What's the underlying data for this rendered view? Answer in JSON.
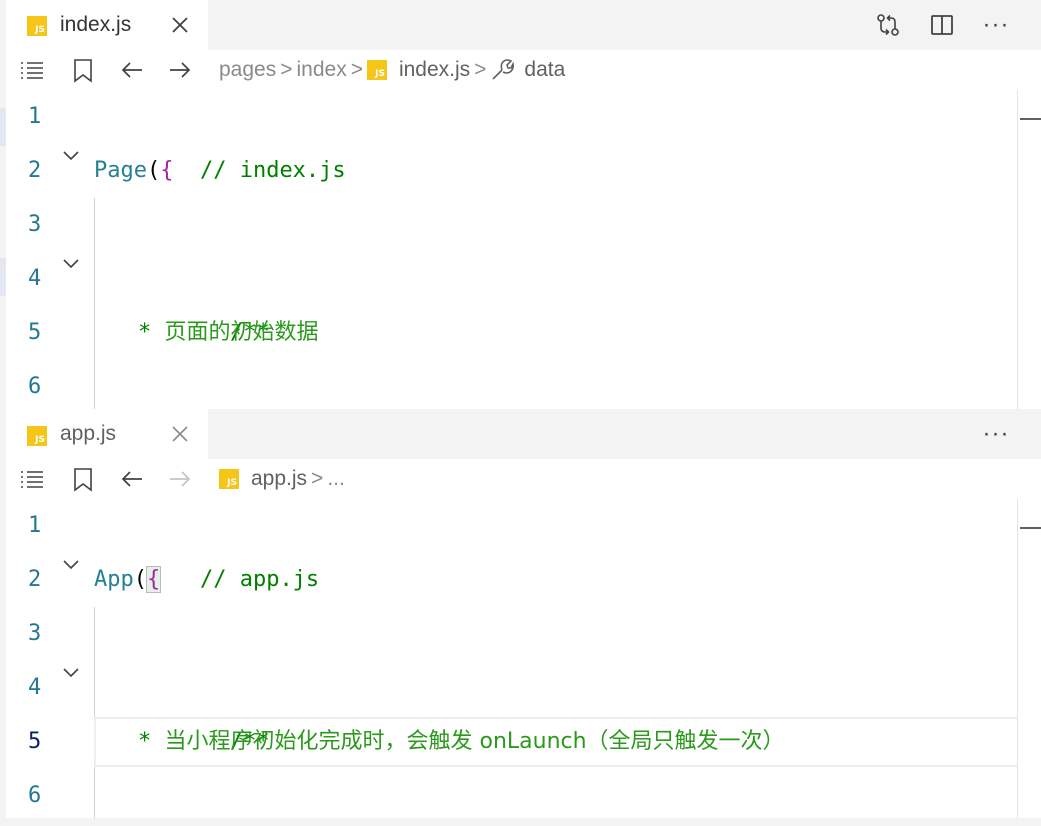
{
  "theme": {
    "tab_active_bg": "#ffffff",
    "tab_bar_bg": "#f3f3f3",
    "js_icon_color": "#f5c518",
    "line_number_color": "#237893",
    "comment_color": "#008000",
    "identifier_color": "#267f99",
    "brace_color": "#a626a4"
  },
  "top_editor": {
    "tab": {
      "icon_text": "JS",
      "label": "index.js",
      "close_icon": "close-icon"
    },
    "actions": [
      "compare-changes-icon",
      "split-editor-icon",
      "more-actions-icon"
    ],
    "more_label": "···",
    "nav": {
      "list_icon": "outline-icon",
      "bookmark_icon": "bookmark-icon",
      "back_icon": "arrow-left-icon",
      "forward_icon": "arrow-right-icon"
    },
    "breadcrumbs": {
      "folder1": "pages",
      "folder2": "index",
      "file_icon": "JS",
      "file": "index.js",
      "symbol_icon": "wrench-icon",
      "symbol": "data",
      "separator": ">"
    },
    "lines": [
      {
        "number": "1",
        "text": "// index.js"
      },
      {
        "number": "2",
        "ident": "Page",
        "paren": "(",
        "brace": "{"
      },
      {
        "number": "3",
        "text": ""
      },
      {
        "number": "4",
        "text": "/**"
      },
      {
        "number": "5",
        "prefix": "* ",
        "text": "页面的初始数据"
      },
      {
        "number": "6",
        "text": "*/"
      }
    ]
  },
  "bottom_editor": {
    "tab": {
      "icon_text": "JS",
      "label": "app.js",
      "close_icon": "close-icon"
    },
    "actions": [
      "more-actions-icon"
    ],
    "more_label": "···",
    "nav": {
      "list_icon": "outline-icon",
      "bookmark_icon": "bookmark-icon",
      "back_icon": "arrow-left-icon",
      "forward_icon": "arrow-right-icon"
    },
    "breadcrumbs": {
      "file_icon": "JS",
      "file": "app.js",
      "separator": ">",
      "ellipsis": "..."
    },
    "lines": [
      {
        "number": "1",
        "text": "// app.js"
      },
      {
        "number": "2",
        "ident": "App",
        "paren": "(",
        "brace": "{"
      },
      {
        "number": "3",
        "text": ""
      },
      {
        "number": "4",
        "text": "/**"
      },
      {
        "number": "5",
        "prefix": "* ",
        "text": "当小程序初始化完成时，会触发 onLaunch（全局只触发一次）"
      },
      {
        "number": "6",
        "text": "*/"
      }
    ]
  }
}
